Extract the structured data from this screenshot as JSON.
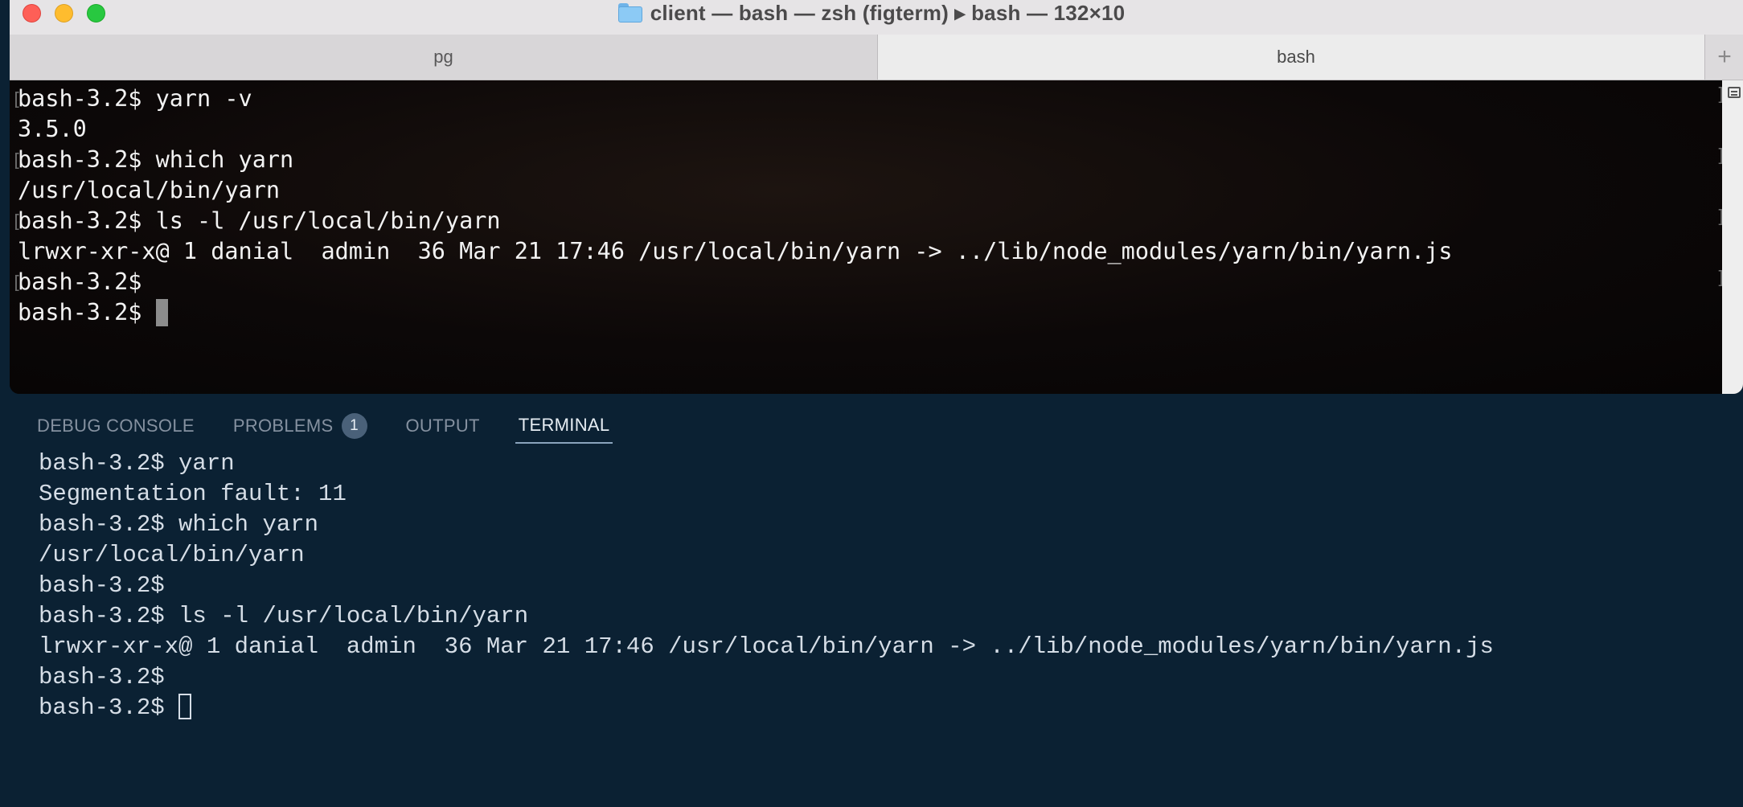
{
  "window": {
    "title": "client — bash — zsh (figterm) ▸ bash — 132×10",
    "folder_icon": "folder-icon"
  },
  "tabs": [
    {
      "label": "pg",
      "active": false
    },
    {
      "label": "bash",
      "active": true
    }
  ],
  "new_tab_label": "+",
  "terminal_lines": [
    "bash-3.2$ yarn -v",
    "3.5.0",
    "bash-3.2$ which yarn",
    "/usr/local/bin/yarn",
    "bash-3.2$ ls -l /usr/local/bin/yarn",
    "lrwxr-xr-x@ 1 danial  admin  36 Mar 21 17:46 /usr/local/bin/yarn -> ../lib/node_modules/yarn/bin/yarn.js",
    "bash-3.2$",
    "bash-3.2$ "
  ],
  "panel": {
    "tabs": [
      {
        "label": "DEBUG CONSOLE",
        "active": false
      },
      {
        "label": "PROBLEMS",
        "active": false,
        "badge": "1"
      },
      {
        "label": "OUTPUT",
        "active": false
      },
      {
        "label": "TERMINAL",
        "active": true
      }
    ],
    "terminal_lines": [
      "bash-3.2$ yarn",
      "Segmentation fault: 11",
      "bash-3.2$ which yarn",
      "/usr/local/bin/yarn",
      "bash-3.2$",
      "bash-3.2$ ls -l /usr/local/bin/yarn",
      "lrwxr-xr-x@ 1 danial  admin  36 Mar 21 17:46 /usr/local/bin/yarn -> ../lib/node_modules/yarn/bin/yarn.js",
      "bash-3.2$",
      "bash-3.2$ "
    ]
  },
  "colors": {
    "terminal_bg": "#0a0707",
    "terminal_text": "#f2f2f2",
    "panel_bg": "#0b2133",
    "panel_text": "#d5dde6",
    "close": "#fe5f57",
    "minimize": "#febc2e",
    "zoom": "#28c840"
  }
}
